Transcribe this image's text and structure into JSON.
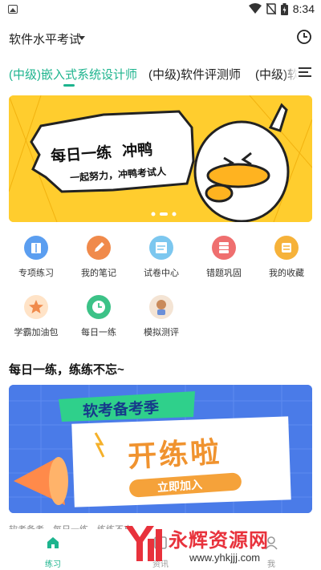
{
  "status_bar": {
    "time": "8:34"
  },
  "header": {
    "title": "软件水平考试"
  },
  "tabs": [
    {
      "label": "(中级)嵌入式系统设计师"
    },
    {
      "label": "(中级)软件评测师"
    },
    {
      "label": "(中级)软"
    }
  ],
  "banner": {
    "title": "每日一练  冲鸭",
    "subtitle": "一起努力，冲鸭考试人"
  },
  "grid": [
    {
      "label": "专项练习",
      "color": "#5b9ef0"
    },
    {
      "label": "我的笔记",
      "color": "#f08a4b"
    },
    {
      "label": "试卷中心",
      "color": "#5fb7e8"
    },
    {
      "label": "错题巩固",
      "color": "#ef6f6f"
    },
    {
      "label": "我的收藏",
      "color": "#f6b23a"
    },
    {
      "label": "学霸加油包",
      "color": "#f08a4b"
    },
    {
      "label": "每日一练",
      "color": "#3cc287"
    },
    {
      "label": "模拟测评",
      "color": "#c98a5a"
    }
  ],
  "section": {
    "title": "每日一练，练练不忘~"
  },
  "card": {
    "headline": "软考备考季",
    "main": "开练啦",
    "button": "立即加入"
  },
  "caption": "软考备考，每日一练，练练不忘",
  "bottom_nav": [
    {
      "label": "练习"
    },
    {
      "label": "资讯"
    },
    {
      "label": "我"
    }
  ],
  "watermark": {
    "text": "永辉资源网",
    "url": "www.yhkjjj.com"
  },
  "colors": {
    "accent": "#1db48e",
    "banner_bg": "#ffcd2e",
    "card_bg": "#4a7be8"
  }
}
